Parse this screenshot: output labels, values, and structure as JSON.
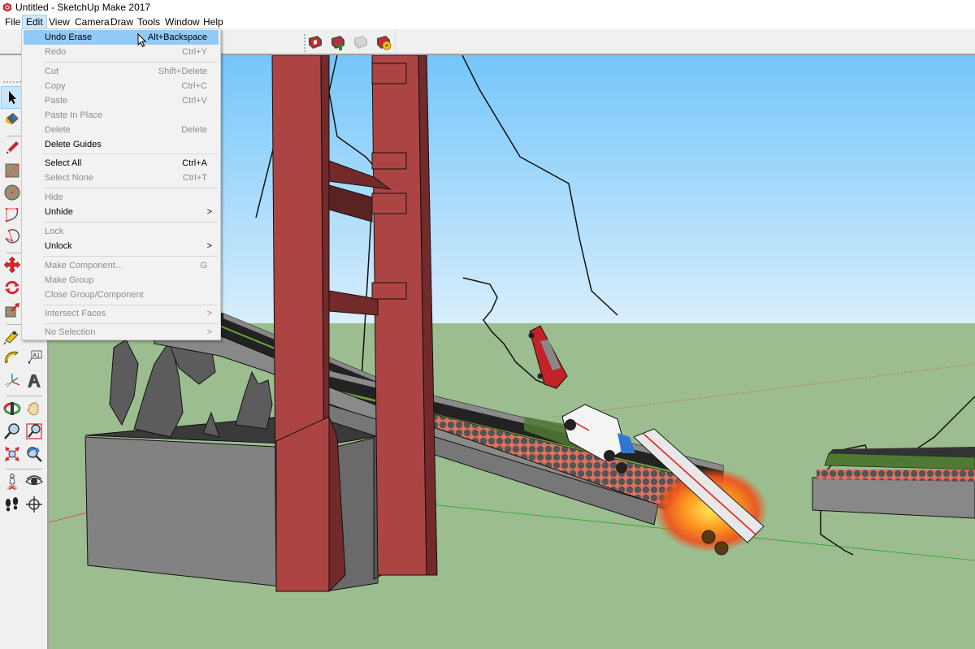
{
  "window": {
    "title": "Untitled - SketchUp Make 2017",
    "app_icon": "sketchup-logo-icon"
  },
  "menubar": {
    "items": [
      {
        "label": "File"
      },
      {
        "label": "Edit",
        "active": true
      },
      {
        "label": "View"
      },
      {
        "label": "Camera"
      },
      {
        "label": "Draw"
      },
      {
        "label": "Tools"
      },
      {
        "label": "Window"
      },
      {
        "label": "Help"
      }
    ]
  },
  "top_toolbar": {
    "icons": [
      "3d-warehouse-icon",
      "share-model-icon",
      "extension-warehouse-icon",
      "extension-manager-icon"
    ]
  },
  "edit_menu": {
    "items": [
      {
        "label": "Undo Erase",
        "shortcut": "Alt+Backspace",
        "enabled": true,
        "highlighted": true
      },
      {
        "label": "Redo",
        "shortcut": "Ctrl+Y",
        "enabled": false
      },
      {
        "label": "Cut",
        "shortcut": "Shift+Delete",
        "enabled": false
      },
      {
        "label": "Copy",
        "shortcut": "Ctrl+C",
        "enabled": false
      },
      {
        "label": "Paste",
        "shortcut": "Ctrl+V",
        "enabled": false
      },
      {
        "label": "Paste In Place",
        "shortcut": "",
        "enabled": false
      },
      {
        "label": "Delete",
        "shortcut": "Delete",
        "enabled": false
      },
      {
        "label": "Delete Guides",
        "shortcut": "",
        "enabled": true
      },
      {
        "label": "Select All",
        "shortcut": "Ctrl+A",
        "enabled": true
      },
      {
        "label": "Select None",
        "shortcut": "Ctrl+T",
        "enabled": false
      },
      {
        "label": "Hide",
        "shortcut": "",
        "enabled": false
      },
      {
        "label": "Unhide",
        "shortcut": "",
        "enabled": true,
        "submenu": true
      },
      {
        "label": "Lock",
        "shortcut": "",
        "enabled": false
      },
      {
        "label": "Unlock",
        "shortcut": "",
        "enabled": true,
        "submenu": true
      },
      {
        "label": "Make Component...",
        "shortcut": "G",
        "enabled": false
      },
      {
        "label": "Make Group",
        "shortcut": "",
        "enabled": false
      },
      {
        "label": "Close Group/Component",
        "shortcut": "",
        "enabled": false
      },
      {
        "label": "Intersect Faces",
        "shortcut": "",
        "enabled": false,
        "submenu": true
      },
      {
        "label": "No Selection",
        "shortcut": "",
        "enabled": false,
        "submenu": true
      }
    ],
    "submenu_arrow": ">"
  },
  "left_toolbar": {
    "tools": [
      {
        "name": "select-tool",
        "selected": true
      },
      {
        "name": "paint-bucket-tool"
      },
      {
        "name": "pencil-line-tool"
      },
      {
        "name": "rectangle-tool"
      },
      {
        "name": "circle-tool"
      },
      {
        "name": "arc-tool"
      },
      {
        "name": "pie-tool"
      },
      {
        "name": "move-tool"
      },
      {
        "name": "rotate-tool"
      },
      {
        "name": "scale-tool"
      },
      {
        "name": "tape-measure-tool"
      },
      {
        "name": "text-tool"
      },
      {
        "name": "protractor-tool"
      },
      {
        "name": "3d-text-tool"
      },
      {
        "name": "axes-tool"
      },
      {
        "name": "section-plane-tool"
      },
      {
        "name": "orbit-tool"
      },
      {
        "name": "pan-tool"
      },
      {
        "name": "zoom-tool"
      },
      {
        "name": "zoom-window-tool"
      },
      {
        "name": "zoom-extents-tool"
      },
      {
        "name": "previous-view-tool"
      },
      {
        "name": "position-camera-tool"
      },
      {
        "name": "look-around-tool"
      },
      {
        "name": "walk-tool"
      },
      {
        "name": "section-display-tool"
      }
    ],
    "text_tool_label": "A1"
  },
  "scene": {
    "sky_top": "#74c6fb",
    "sky_bottom": "#d8eefb",
    "ground": "#9bbd8f",
    "tower_red": "#ad4444",
    "tower_dark": "#732a2a",
    "concrete": "#828282",
    "road_dark": "#222222",
    "grass_stripe": "#6aa53a"
  }
}
